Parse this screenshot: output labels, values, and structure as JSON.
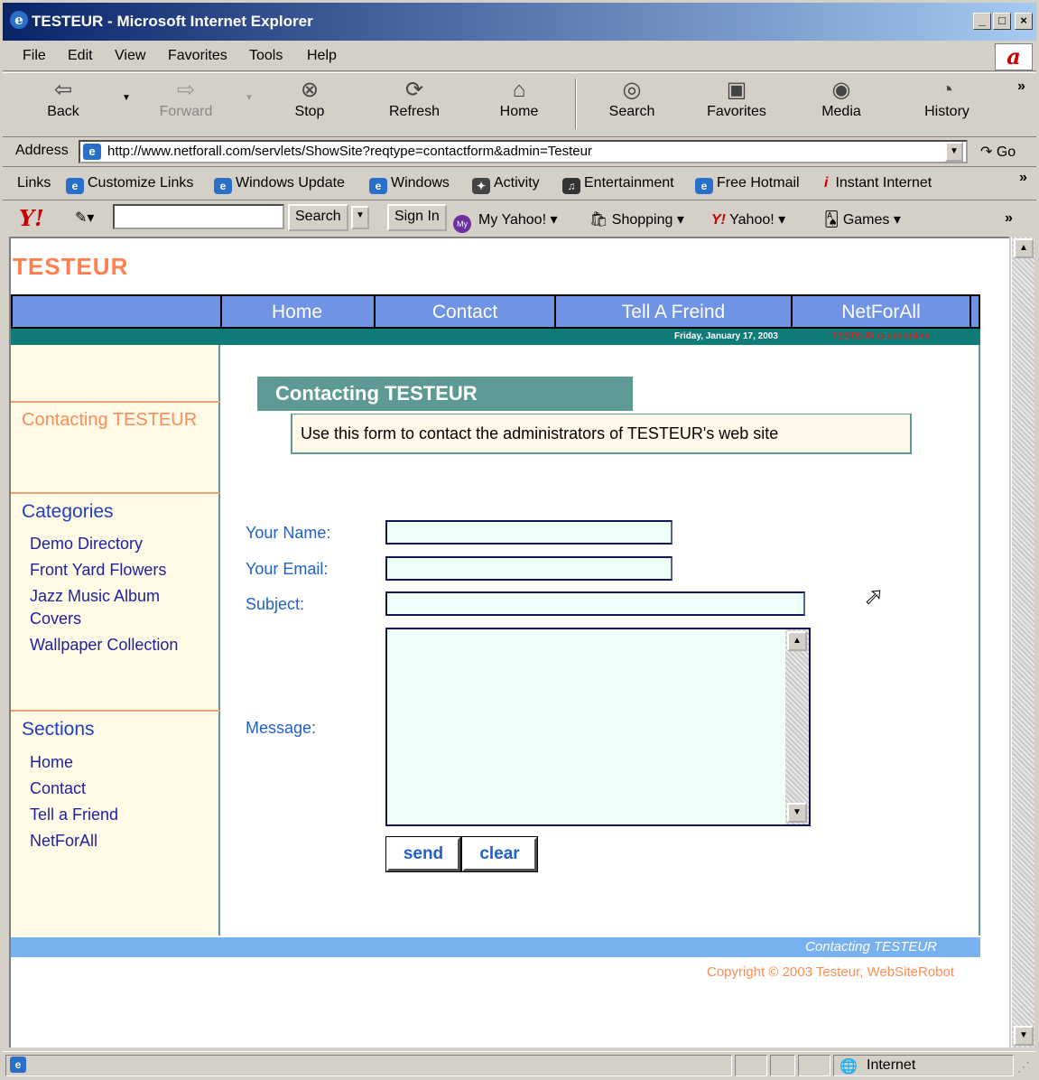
{
  "window": {
    "title": "TESTEUR - Microsoft Internet Explorer",
    "min": "_",
    "max": "□",
    "close": "×"
  },
  "menu": [
    "File",
    "Edit",
    "View",
    "Favorites",
    "Tools",
    "Help"
  ],
  "toolbar": {
    "back": "Back",
    "forward": "Forward",
    "stop": "Stop",
    "refresh": "Refresh",
    "home": "Home",
    "search": "Search",
    "favorites": "Favorites",
    "media": "Media",
    "history": "History",
    "more": "»"
  },
  "address": {
    "label": "Address",
    "url": "http://www.netforall.com/servlets/ShowSite?reqtype=contactform&admin=Testeur",
    "go": "Go"
  },
  "links": {
    "label": "Links",
    "items": [
      "Customize Links",
      "Windows Update",
      "Windows",
      "Activity",
      "Entertainment",
      "Free Hotmail",
      "Instant Internet"
    ]
  },
  "yahoo": {
    "search_button": "Search",
    "sign_in": "Sign In",
    "my_yahoo": "My Yahoo!",
    "shopping": "Shopping",
    "yahoo": "Yahoo!",
    "games": "Games",
    "more": "»"
  },
  "page": {
    "site_title": "TESTEUR",
    "nav": [
      "Home",
      "Contact",
      "Tell A Freind",
      "NetForAll"
    ],
    "date": "Friday, January 17, 2003",
    "status_text": "TESTEUR is not online",
    "sidebar": {
      "active": "Contacting TESTEUR",
      "categories_heading": "Categories",
      "categories": [
        "Demo Directory",
        "Front Yard Flowers",
        "Jazz Music Album Covers",
        "Wallpaper Collection"
      ],
      "sections_heading": "Sections",
      "sections": [
        "Home",
        "Contact",
        "Tell a Friend",
        "NetForAll"
      ]
    },
    "contact": {
      "heading": "Contacting TESTEUR",
      "description": "Use this form to contact the administrators of TESTEUR's web site",
      "name_label": "Your Name:",
      "email_label": "Your Email:",
      "subject_label": "Subject:",
      "message_label": "Message:",
      "name_value": "",
      "email_value": "",
      "subject_value": "",
      "message_value": "",
      "send": "send",
      "clear": "clear"
    },
    "footer": "Contacting TESTEUR",
    "copyright": "Copyright © 2003 Testeur, WebSiteRobot"
  },
  "status": {
    "zone": "Internet"
  },
  "colors": {
    "site_title": "#ff7f50",
    "nav_bg": "#6f93e5",
    "teal": "#0f7c78",
    "sidebar_bg": "#fffae6",
    "link": "#1f5fcf"
  }
}
